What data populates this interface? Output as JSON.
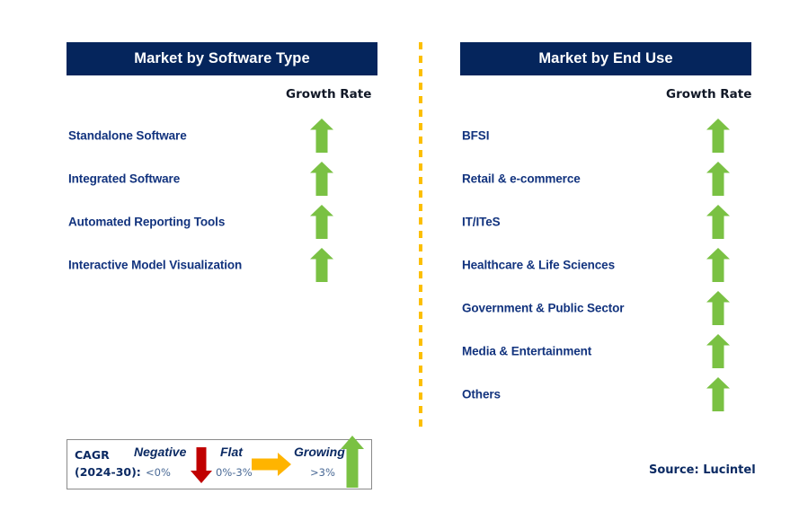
{
  "colors": {
    "header_bg": "#05255c",
    "header_text": "#ffffff",
    "label_navy": "#12337e",
    "growth_up": "#7ac143",
    "growth_down": "#c00000",
    "growth_flat": "#ffb400",
    "divider": "#fcbf00",
    "source_text": "#0b2a63"
  },
  "panels": [
    {
      "id": "software",
      "title": "Market by Software Type",
      "growth_rate_label": "Growth Rate",
      "items": [
        {
          "label": "Standalone Software",
          "growth": "up"
        },
        {
          "label": "Integrated Software",
          "growth": "up"
        },
        {
          "label": "Automated Reporting Tools",
          "growth": "up"
        },
        {
          "label": "Interactive Model Visualization",
          "growth": "up"
        }
      ]
    },
    {
      "id": "enduse",
      "title": "Market by End Use",
      "growth_rate_label": "Growth Rate",
      "items": [
        {
          "label": "BFSI",
          "growth": "up"
        },
        {
          "label": "Retail & e-commerce",
          "growth": "up"
        },
        {
          "label": "IT/ITeS",
          "growth": "up"
        },
        {
          "label": "Healthcare & Life Sciences",
          "growth": "up"
        },
        {
          "label": "Government & Public Sector",
          "growth": "up"
        },
        {
          "label": "Media & Entertainment",
          "growth": "up"
        },
        {
          "label": "Others",
          "growth": "up"
        }
      ]
    }
  ],
  "legend": {
    "title_line1": "CAGR",
    "title_line2": "(2024-30):",
    "entries": [
      {
        "name": "Negative",
        "range": "<0%",
        "icon": "arrow-down-icon"
      },
      {
        "name": "Flat",
        "range": "0%-3%",
        "icon": "arrow-right-icon"
      },
      {
        "name": "Growing",
        "range": ">3%",
        "icon": "arrow-up-icon"
      }
    ]
  },
  "source": "Source: Lucintel"
}
